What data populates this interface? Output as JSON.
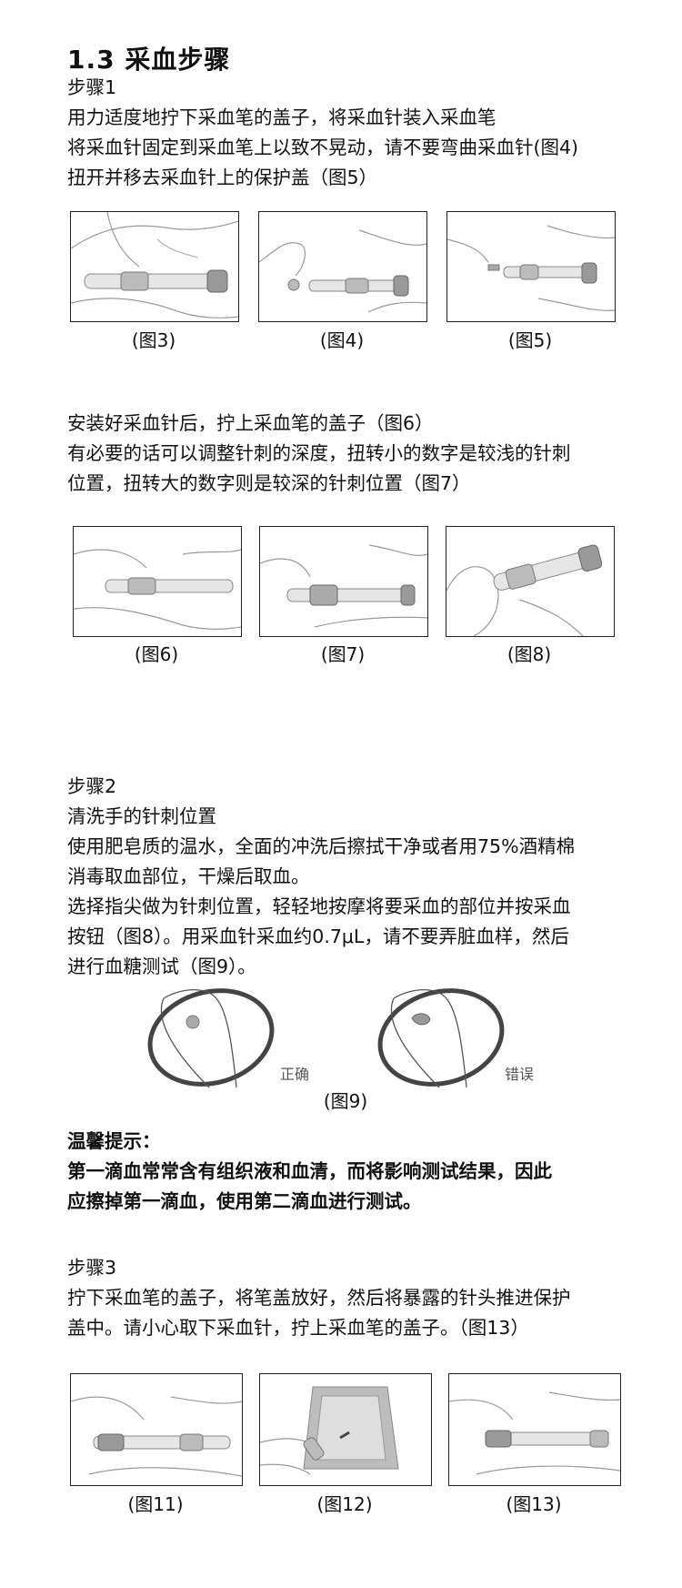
{
  "title": "1.3 采血步骤",
  "step1": {
    "heading": "步骤1",
    "lines": [
      "用力适度地拧下采血笔的盖子，将采血针装入采血笔",
      "将采血针固定到采血笔上以致不晃动，请不要弯曲采血针(图4)",
      "扭开并移去采血针上的保护盖（图5）"
    ]
  },
  "row1_captions": [
    "(图3)",
    "(图4)",
    "(图5)"
  ],
  "step1b": {
    "lines": [
      "安装好采血针后，拧上采血笔的盖子（图6）",
      "有必要的话可以调整针刺的深度，扭转小的数字是较浅的针刺",
      "位置，扭转大的数字则是较深的针刺位置（图7）"
    ]
  },
  "row2_captions": [
    "(图6)",
    "(图7)",
    "(图8)"
  ],
  "step2": {
    "heading": "步骤2",
    "lines": [
      "清洗手的针刺位置",
      "使用肥皂质的温水，全面的冲洗后擦拭干净或者用75%酒精棉",
      "消毒取血部位，干燥后取血。",
      "选择指尖做为针刺位置，轻轻地按摩将要采血的部位并按采血",
      "按钮（图8）。用采血针采血约0.7μL，请不要弄脏血样，然后",
      "进行血糖测试（图9）。"
    ]
  },
  "fig9": {
    "correct_label": "正确",
    "wrong_label": "错误",
    "caption": "(图9)"
  },
  "tip": {
    "heading": "温馨提示：",
    "lines": [
      "第一滴血常常含有组织液和血清，而将影响测试结果，因此",
      "应擦掉第一滴血，使用第二滴血进行测试。"
    ]
  },
  "step3": {
    "heading": "步骤3",
    "lines": [
      "拧下采血笔的盖子，将笔盖放好，然后将暴露的针头推进保护",
      "盖中。请小心取下采血针，拧上采血笔的盖子。（图13）"
    ]
  },
  "row3_captions": [
    "(图11)",
    "(图12)",
    "(图13)"
  ]
}
